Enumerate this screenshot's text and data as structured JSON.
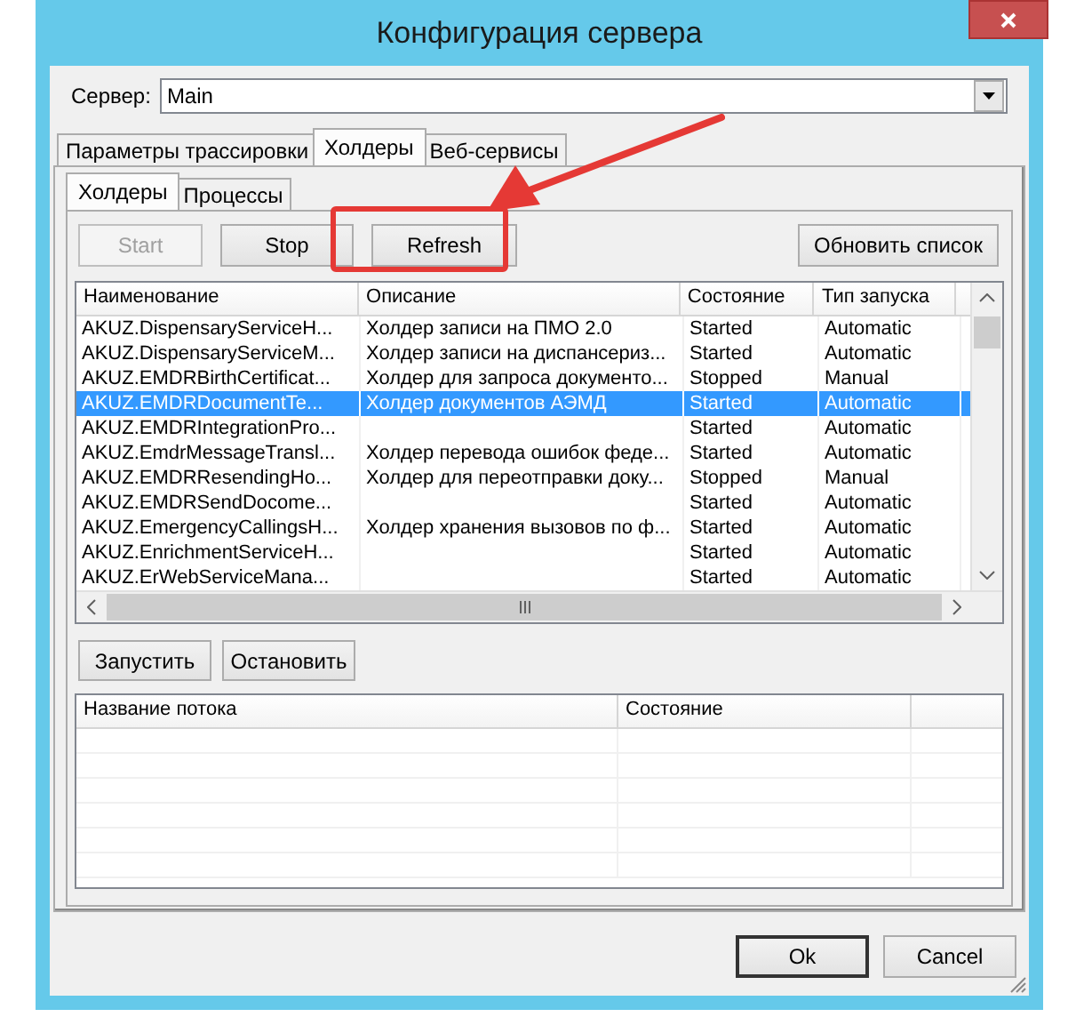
{
  "window": {
    "title": "Конфигурация сервера"
  },
  "server": {
    "label": "Сервер:",
    "value": "Main"
  },
  "tabs": [
    {
      "label": "Параметры трассировки",
      "selected": false
    },
    {
      "label": "Холдеры",
      "selected": true
    },
    {
      "label": "Веб-сервисы",
      "selected": false
    }
  ],
  "subtabs": [
    {
      "label": "Холдеры",
      "selected": true
    },
    {
      "label": "Процессы",
      "selected": false
    }
  ],
  "toolbar": [
    {
      "label": "Start",
      "disabled": true
    },
    {
      "label": "Stop",
      "disabled": false
    },
    {
      "label": "Refresh",
      "disabled": false
    },
    {
      "label": "Обновить список",
      "disabled": false
    }
  ],
  "holders": {
    "columns": [
      "Наименование",
      "Описание",
      "Состояние",
      "Тип запуска"
    ],
    "rows": [
      {
        "name": "AKUZ.DispensaryServiceH...",
        "description": "Холдер записи на ПМО 2.0",
        "state": "Started",
        "startup": "Automatic",
        "selected": false
      },
      {
        "name": "AKUZ.DispensaryServiceM...",
        "description": "Холдер записи на диспансериз...",
        "state": "Started",
        "startup": "Automatic",
        "selected": false
      },
      {
        "name": "AKUZ.EMDRBirthCertificat...",
        "description": "Холдер для запроса документо...",
        "state": "Stopped",
        "startup": "Manual",
        "selected": false
      },
      {
        "name": "AKUZ.EMDRDocumentTe...",
        "description": "Холдер документов АЭМД",
        "state": "Started",
        "startup": "Automatic",
        "selected": true
      },
      {
        "name": "AKUZ.EMDRIntegrationPro...",
        "description": "",
        "state": "Started",
        "startup": "Automatic",
        "selected": false
      },
      {
        "name": "AKUZ.EmdrMessageTransl...",
        "description": "Холдер перевода ошибок феде...",
        "state": "Started",
        "startup": "Automatic",
        "selected": false
      },
      {
        "name": "AKUZ.EMDRResendingHo...",
        "description": "Холдер для переотправки доку...",
        "state": "Stopped",
        "startup": "Manual",
        "selected": false
      },
      {
        "name": "AKUZ.EMDRSendDocome...",
        "description": "",
        "state": "Started",
        "startup": "Automatic",
        "selected": false
      },
      {
        "name": "AKUZ.EmergencyCallingsH...",
        "description": "Холдер хранения вызовов по ф...",
        "state": "Started",
        "startup": "Automatic",
        "selected": false
      },
      {
        "name": "AKUZ.EnrichmentServiceH...",
        "description": "",
        "state": "Started",
        "startup": "Automatic",
        "selected": false
      },
      {
        "name": "AKUZ.ErWebServiceMana...",
        "description": "",
        "state": "Started",
        "startup": "Automatic",
        "selected": false
      }
    ]
  },
  "thread_buttons": [
    {
      "label": "Запустить"
    },
    {
      "label": "Остановить"
    }
  ],
  "threads": {
    "columns": [
      "Название потока",
      "Состояние"
    ]
  },
  "footer": [
    {
      "label": "Ok",
      "default": true
    },
    {
      "label": "Cancel",
      "default": false
    }
  ]
}
